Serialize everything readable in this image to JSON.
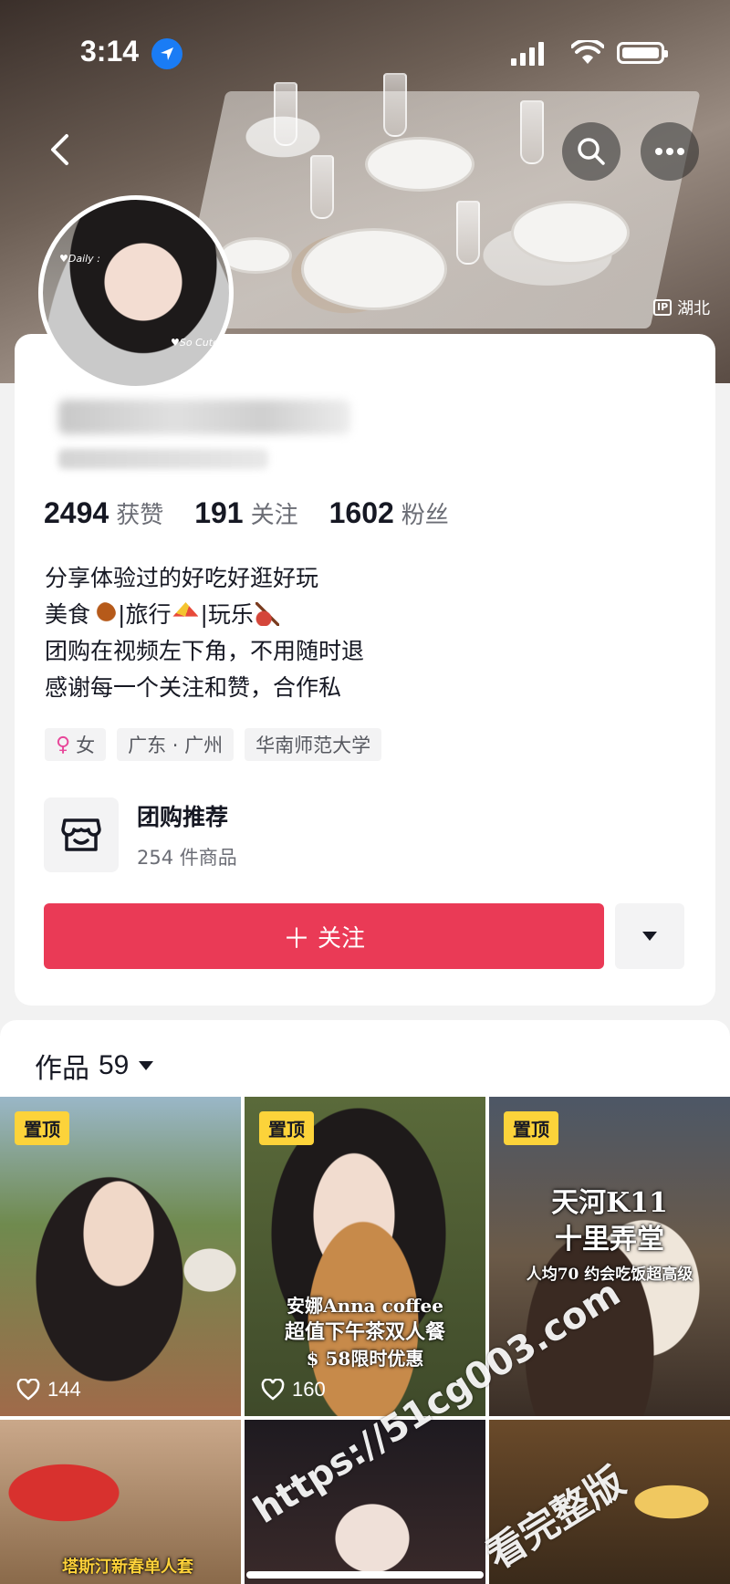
{
  "status_bar": {
    "time": "3:14"
  },
  "hero": {
    "ip_label": "IP",
    "ip_location": "湖北"
  },
  "profile": {
    "avatar_tag_a": "♥Daily :",
    "avatar_tag_b": "♥So Cute",
    "stats": [
      {
        "num": "2494",
        "label": "获赞"
      },
      {
        "num": "191",
        "label": "关注"
      },
      {
        "num": "1602",
        "label": "粉丝"
      }
    ],
    "bio": {
      "line1": "分享体验过的好吃好逛好玩",
      "line2_a": "美食",
      "line2_b": "|旅行",
      "line2_c": "|玩乐",
      "line3": "团购在视频左下角，不用随时退",
      "line4": "感谢每一个关注和赞，合作私"
    },
    "tags": {
      "gender": "女",
      "location": "广东 · 广州",
      "school": "华南师范大学"
    },
    "groupbuy": {
      "title": "团购推荐",
      "subtitle": "254 件商品"
    },
    "follow_label": "关注"
  },
  "works": {
    "label": "作品",
    "count": "59",
    "tiles": [
      {
        "pin": "置顶",
        "likes": "144"
      },
      {
        "pin": "置顶",
        "likes": "160",
        "caption_1": "安娜Anna coffee",
        "caption_2": "超值下午茶双人餐",
        "caption_3": "$ 58限时优惠"
      },
      {
        "pin": "置顶",
        "caption_1": "天河K11",
        "caption_2": "十里弄堂",
        "caption_3": "人均70 约会吃饭超高级"
      },
      {
        "caption_1": "塔斯汀新春单人套"
      },
      {},
      {}
    ]
  },
  "watermark": {
    "url": "https://51cg003.com",
    "text": "看完整版"
  },
  "colors": {
    "follow": "#ea3a56",
    "pin_badge": "#fcd33a",
    "location_blue": "#1a7cf5"
  }
}
